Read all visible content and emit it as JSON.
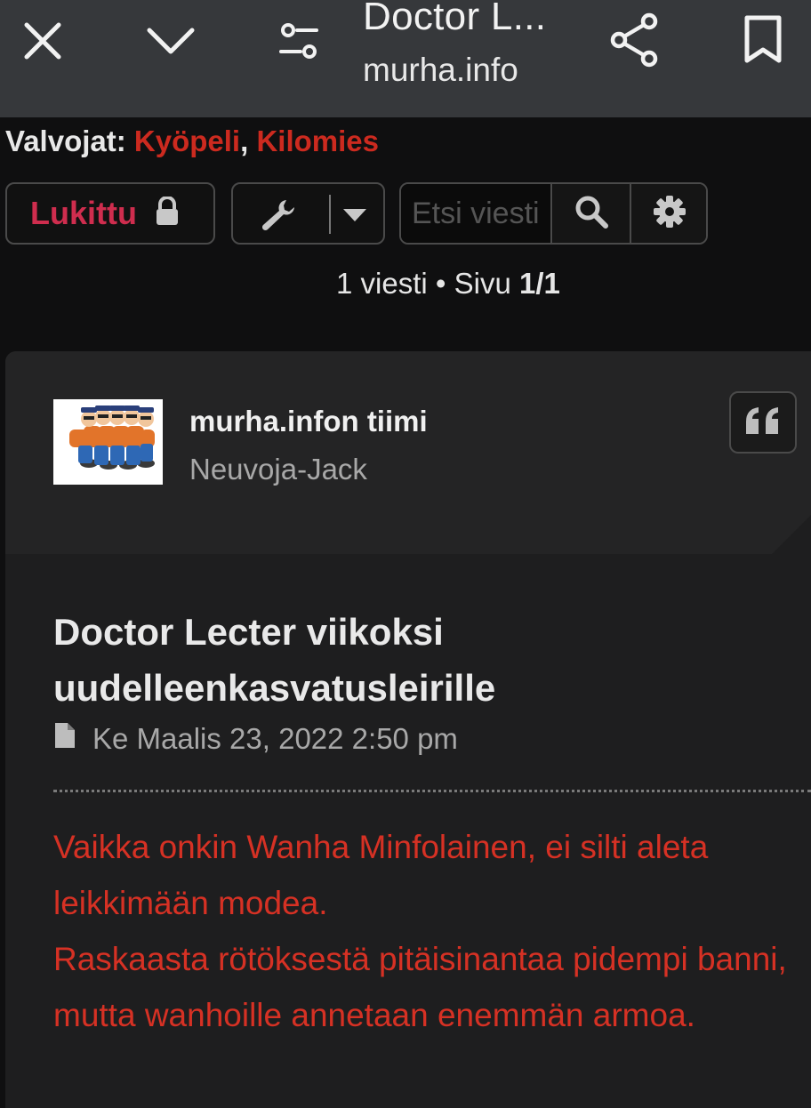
{
  "browser": {
    "title": "Doctor L...",
    "url": "murha.info"
  },
  "moderators": {
    "label": "Valvojat:",
    "names": [
      "Kyöpeli",
      "Kilomies"
    ],
    "separator": ","
  },
  "actions": {
    "locked_label": "Lukittu",
    "search_placeholder": "Etsi viesti"
  },
  "pagination": {
    "count_text": "1 viesti • Sivu ",
    "page": "1/1"
  },
  "post": {
    "author": "murha.infon tiimi",
    "rank": "Neuvoja-Jack",
    "title": "Doctor Lecter viikoksi uudelleenkasvatusleirille",
    "date": "Ke Maalis 23, 2022 2:50 pm",
    "body": [
      "Vaikka onkin Wanha Minfolainen, ei silti aleta leikkimään modea.",
      "Raskaasta rötöksestä pitäisinantaa pidempi banni, mutta wanhoille annetaan enemmän armoa."
    ]
  },
  "colors": {
    "moderator": "#cc2a1f",
    "locked": "#cf2d4e",
    "body_text": "#d63124"
  }
}
